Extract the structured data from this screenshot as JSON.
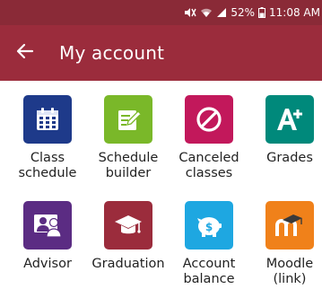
{
  "status_bar": {
    "battery": "52%",
    "time": "11:08 AM",
    "icons": [
      "mute-icon",
      "wifi-icon",
      "signal-icon",
      "battery-icon"
    ]
  },
  "app_bar": {
    "title": "My account",
    "back_icon": "back-arrow-icon"
  },
  "tiles": [
    {
      "label": "Class\nschedule",
      "icon": "calendar-icon",
      "color": "#1e3a8a"
    },
    {
      "label": "Schedule\nbuilder",
      "icon": "edit-note-icon",
      "color": "#7ab829"
    },
    {
      "label": "Canceled\nclasses",
      "icon": "cancel-icon",
      "color": "#c2185b"
    },
    {
      "label": "Grades",
      "icon": "grade-a-plus-icon",
      "color": "#00897b"
    },
    {
      "label": "Advisor",
      "icon": "advisor-icon",
      "color": "#5b2c83"
    },
    {
      "label": "Graduation",
      "icon": "graduation-cap-icon",
      "color": "#9b2c3c"
    },
    {
      "label": "Account\nbalance",
      "icon": "piggy-bank-icon",
      "color": "#1ea7e1"
    },
    {
      "label": "Moodle\n(link)",
      "icon": "moodle-icon",
      "color": "#f0811a"
    }
  ]
}
